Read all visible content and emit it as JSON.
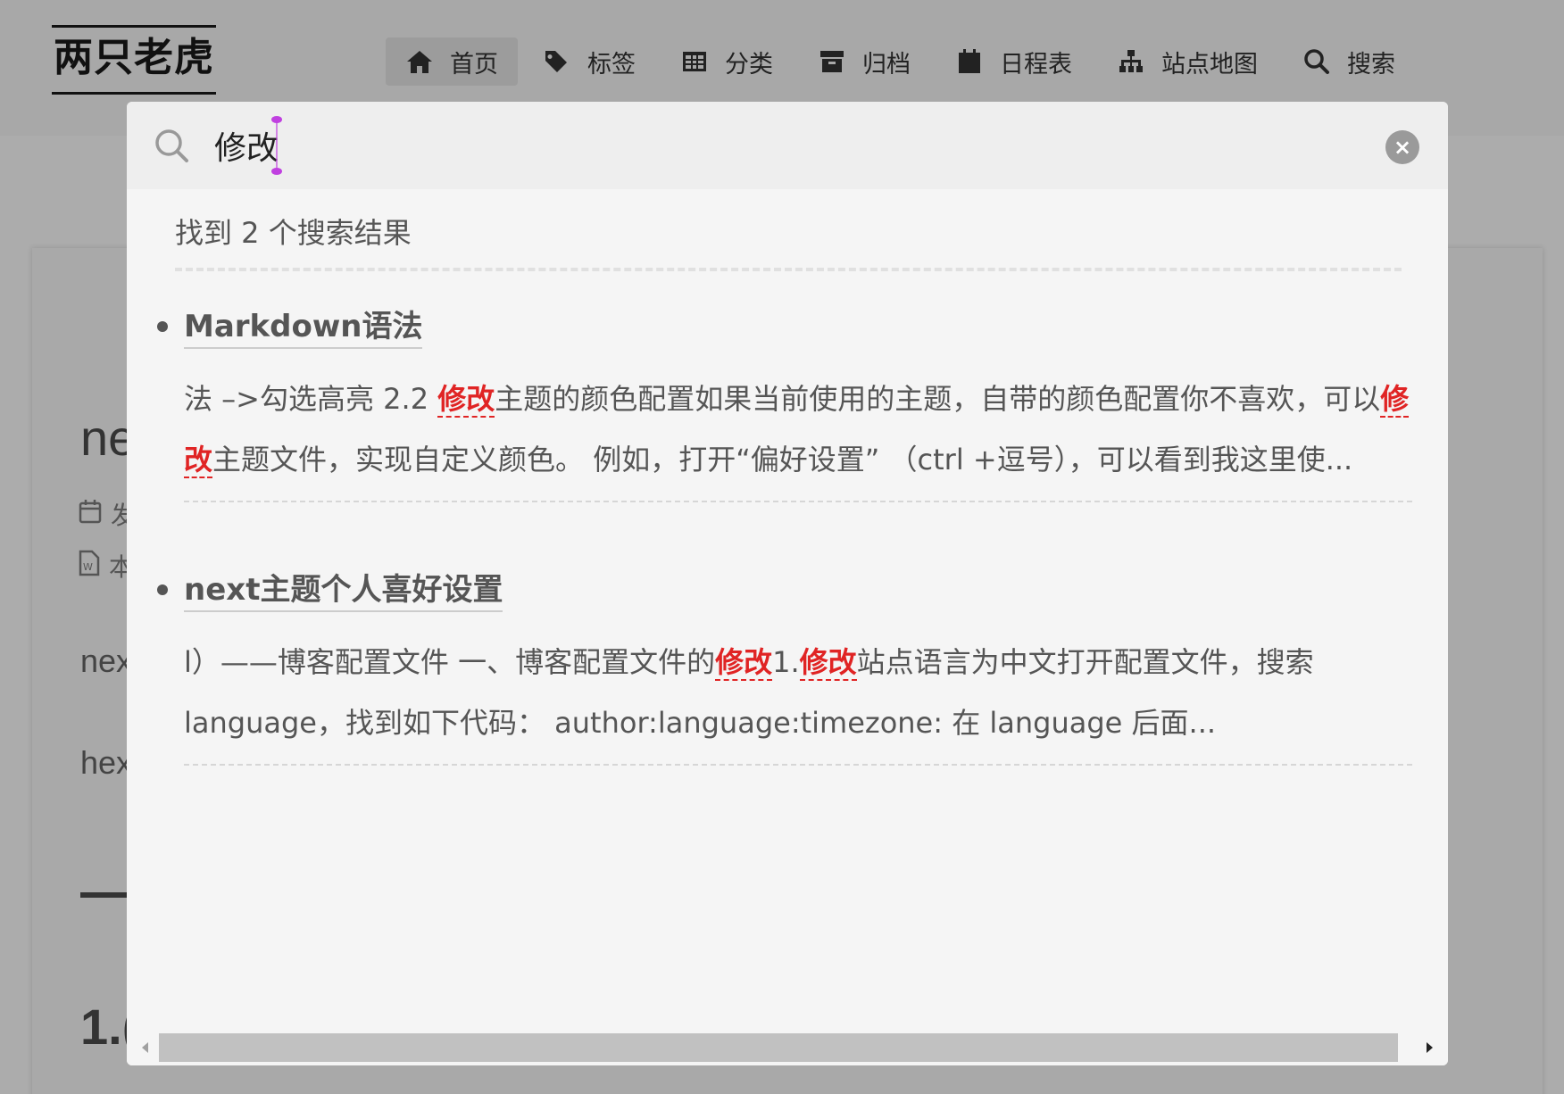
{
  "site": {
    "brand": "两只老虎"
  },
  "nav": {
    "items": [
      {
        "label": "首页",
        "icon": "home-icon",
        "active": true
      },
      {
        "label": "标签",
        "icon": "tags-icon",
        "active": false
      },
      {
        "label": "分类",
        "icon": "table-icon",
        "active": false
      },
      {
        "label": "归档",
        "icon": "archive-icon",
        "active": false
      },
      {
        "label": "日程表",
        "icon": "calendar-icon",
        "active": false
      },
      {
        "label": "站点地图",
        "icon": "sitemap-icon",
        "active": false
      },
      {
        "label": "搜索",
        "icon": "search-icon",
        "active": false
      }
    ]
  },
  "article": {
    "title_fragment": "ne",
    "meta1_fragment": "发",
    "meta2_fragment": "本",
    "p1_fragment": "nex",
    "p2_fragment": "hex",
    "heading_fragment": "1.("
  },
  "search": {
    "query": "修改",
    "summary": "找到 2 个搜索结果",
    "results": [
      {
        "title": "Markdown语法",
        "segments": [
          {
            "text": "法 –>勾选高亮 2.2 ",
            "hl": false
          },
          {
            "text": "修改",
            "hl": true
          },
          {
            "text": "主题的颜色配置如果当前使用的主题，自带的颜色配置你不喜欢，可以",
            "hl": false
          },
          {
            "text": "修改",
            "hl": true
          },
          {
            "text": "主题文件，实现自定义颜色。 例如，打开“偏好设置” （ctrl +逗号），可以看到我这里使...",
            "hl": false
          }
        ]
      },
      {
        "title": "next主题个人喜好设置",
        "segments": [
          {
            "text": "l）——博客配置文件 一、博客配置文件的",
            "hl": false
          },
          {
            "text": "修改",
            "hl": true
          },
          {
            "text": "1.",
            "hl": false
          },
          {
            "text": "修改",
            "hl": true
          },
          {
            "text": "站点语言为中文打开配置文件，搜索language，找到如下代码： author:language:timezone: 在 language 后面...",
            "hl": false
          }
        ]
      }
    ]
  },
  "colors": {
    "highlight": "#e02424",
    "overlay": "#acacac",
    "popup": "#f5f5f5"
  }
}
